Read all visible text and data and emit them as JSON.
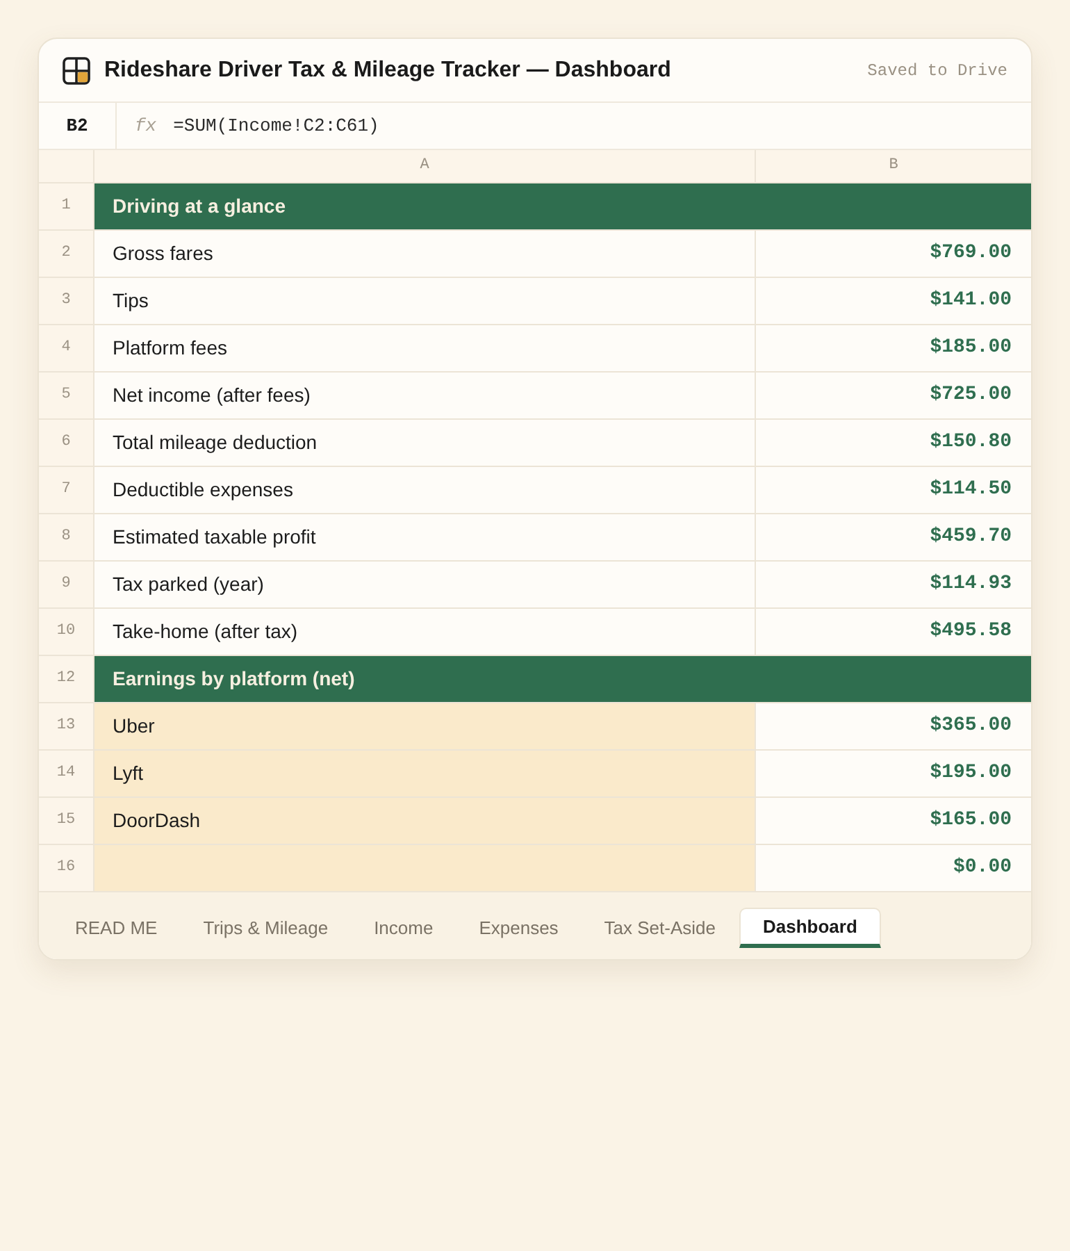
{
  "window": {
    "title": "Rideshare Driver Tax & Mileage Tracker — Dashboard",
    "save_status": "Saved to Drive"
  },
  "formula_bar": {
    "cell_ref": "B2",
    "fx_label": "fx",
    "formula": "=SUM(Income!C2:C61)"
  },
  "columns": [
    "A",
    "B"
  ],
  "rows": [
    {
      "number": "1",
      "kind": "section",
      "label": "Driving at a glance"
    },
    {
      "number": "2",
      "kind": "value",
      "label": "Gross fares",
      "value": "$769.00"
    },
    {
      "number": "3",
      "kind": "value",
      "label": "Tips",
      "value": "$141.00"
    },
    {
      "number": "4",
      "kind": "value",
      "label": "Platform fees",
      "value": "$185.00"
    },
    {
      "number": "5",
      "kind": "value",
      "label": "Net income (after fees)",
      "value": "$725.00"
    },
    {
      "number": "6",
      "kind": "value",
      "label": "Total mileage deduction",
      "value": "$150.80"
    },
    {
      "number": "7",
      "kind": "value",
      "label": "Deductible expenses",
      "value": "$114.50"
    },
    {
      "number": "8",
      "kind": "value",
      "label": "Estimated taxable profit",
      "value": "$459.70"
    },
    {
      "number": "9",
      "kind": "value",
      "label": "Tax parked (year)",
      "value": "$114.93"
    },
    {
      "number": "10",
      "kind": "value",
      "label": "Take-home (after tax)",
      "value": "$495.58"
    },
    {
      "number": "12",
      "kind": "section",
      "label": "Earnings by platform (net)"
    },
    {
      "number": "13",
      "kind": "input",
      "label": "Uber",
      "value": "$365.00"
    },
    {
      "number": "14",
      "kind": "input",
      "label": "Lyft",
      "value": "$195.00"
    },
    {
      "number": "15",
      "kind": "input",
      "label": "DoorDash",
      "value": "$165.00"
    },
    {
      "number": "16",
      "kind": "input",
      "value": "$0.00"
    }
  ],
  "sheet_tabs": [
    {
      "label": "READ ME",
      "selected": false
    },
    {
      "label": "Trips & Mileage",
      "selected": false
    },
    {
      "label": "Income",
      "selected": false
    },
    {
      "label": "Expenses",
      "selected": false
    },
    {
      "label": "Tax Set-Aside",
      "selected": false
    },
    {
      "label": "Dashboard",
      "selected": true
    }
  ]
}
